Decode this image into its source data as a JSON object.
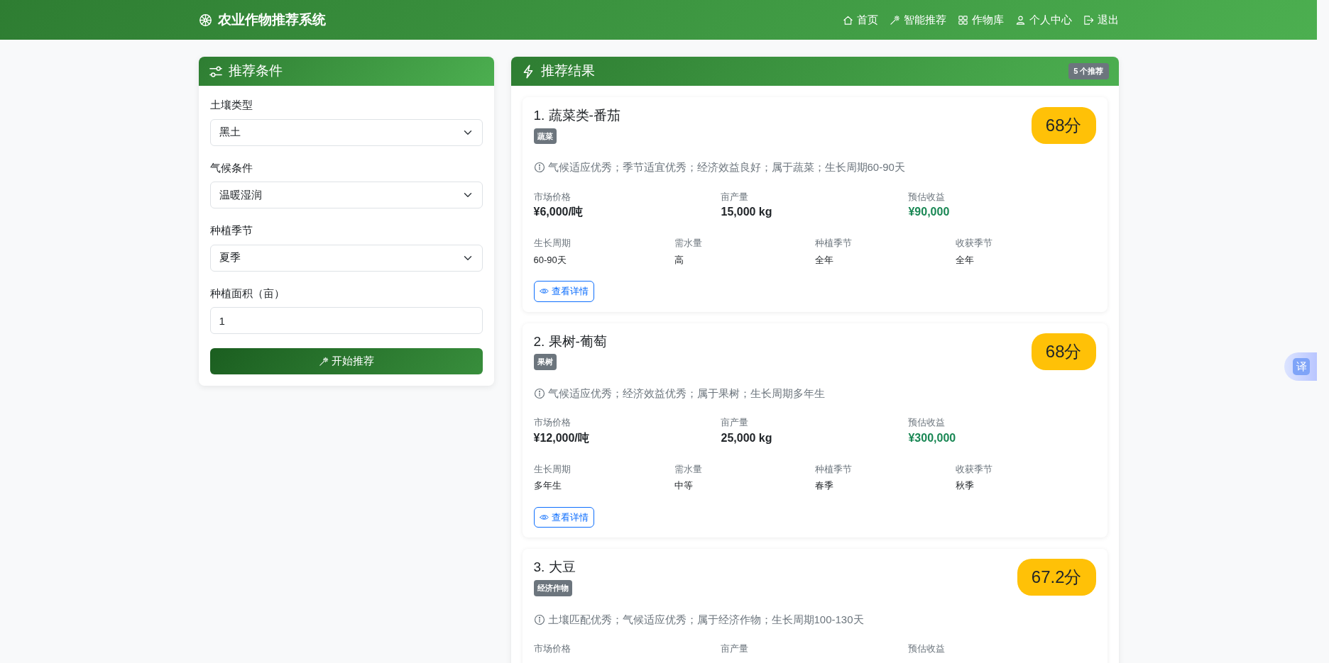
{
  "navbar": {
    "brand": "农业作物推荐系统",
    "links": [
      {
        "label": "首页"
      },
      {
        "label": "智能推荐"
      },
      {
        "label": "作物库"
      },
      {
        "label": "个人中心"
      },
      {
        "label": "退出"
      }
    ]
  },
  "form": {
    "title": "推荐条件",
    "fields": [
      {
        "kind": "select",
        "label": "土壤类型",
        "value": "黑土"
      },
      {
        "kind": "select",
        "label": "气候条件",
        "value": "温暖湿润"
      },
      {
        "kind": "select",
        "label": "种植季节",
        "value": "夏季"
      },
      {
        "kind": "input",
        "label": "种植面积（亩）",
        "value": "1"
      }
    ],
    "submit": "开始推荐"
  },
  "results": {
    "title": "推荐结果",
    "count": "5 个推荐",
    "items": [
      {
        "title": "1. 蔬菜类-番茄",
        "tag": "蔬菜",
        "score": "68分",
        "reason": "气候适应优秀；季节适宜优秀；经济效益良好；属于蔬菜；生长周期60-90天",
        "main_stats": [
          {
            "kind": "plain",
            "label": "市场价格",
            "value": "¥6,000/吨"
          },
          {
            "kind": "plain",
            "label": "亩产量",
            "value": "15,000 kg"
          },
          {
            "kind": "income",
            "label": "预估收益",
            "value": "¥90,000"
          }
        ],
        "details": [
          {
            "label": "生长周期",
            "value": "60-90天"
          },
          {
            "label": "需水量",
            "value": "高"
          },
          {
            "label": "种植季节",
            "value": "全年"
          },
          {
            "label": "收获季节",
            "value": "全年"
          }
        ],
        "action": "查看详情"
      },
      {
        "title": "2. 果树-葡萄",
        "tag": "果树",
        "score": "68分",
        "reason": "气候适应优秀；经济效益优秀；属于果树；生长周期多年生",
        "main_stats": [
          {
            "kind": "plain",
            "label": "市场价格",
            "value": "¥12,000/吨"
          },
          {
            "kind": "plain",
            "label": "亩产量",
            "value": "25,000 kg"
          },
          {
            "kind": "income",
            "label": "预估收益",
            "value": "¥300,000"
          }
        ],
        "details": [
          {
            "label": "生长周期",
            "value": "多年生"
          },
          {
            "label": "需水量",
            "value": "中等"
          },
          {
            "label": "种植季节",
            "value": "春季"
          },
          {
            "label": "收获季节",
            "value": "秋季"
          }
        ],
        "action": "查看详情"
      },
      {
        "title": "3. 大豆",
        "tag": "经济作物",
        "score": "67.2分",
        "reason": "土壤匹配优秀；气候适应优秀；属于经济作物；生长周期100-130天",
        "main_stats": [
          {
            "label": "市场价格"
          },
          {
            "label": "亩产量"
          },
          {
            "label": "预估收益"
          }
        ]
      }
    ]
  },
  "translate_button": "译"
}
